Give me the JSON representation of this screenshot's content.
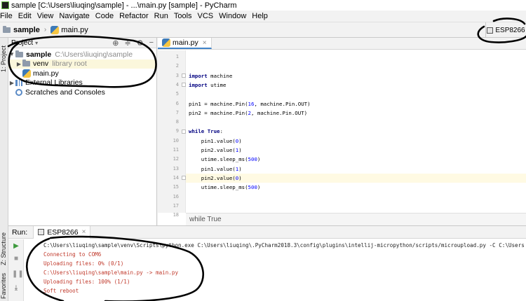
{
  "window": {
    "title": "sample [C:\\Users\\liuqing\\sample] - ...\\main.py [sample] - PyCharm"
  },
  "menu": [
    "File",
    "Edit",
    "View",
    "Navigate",
    "Code",
    "Refactor",
    "Run",
    "Tools",
    "VCS",
    "Window",
    "Help"
  ],
  "nav": {
    "project": "sample",
    "file": "main.py",
    "run_config": "ESP8266"
  },
  "side_tabs": {
    "project": "1: Project",
    "structure": "Z: Structure",
    "favorites": "Favorites"
  },
  "project_panel": {
    "header": "Project",
    "tree": {
      "root_name": "sample",
      "root_path": "C:\\Users\\liuqing\\sample",
      "venv_name": "venv",
      "venv_hint": "library root",
      "file": "main.py",
      "external": "External Libraries",
      "scratches": "Scratches and Consoles"
    }
  },
  "editor": {
    "tab": "main.py",
    "breadcrumb": "while True",
    "current_line": 14,
    "lines": [
      "",
      "",
      "import machine",
      "import utime",
      "",
      "pin1 = machine.Pin(16, machine.Pin.OUT)",
      "pin2 = machine.Pin(2, machine.Pin.OUT)",
      "",
      "while True:",
      "    pin1.value(0)",
      "    pin2.value(1)",
      "    utime.sleep_ms(500)",
      "    pin1.value(1)",
      "    pin2.value(0)",
      "    utime.sleep_ms(500)",
      "",
      "",
      ""
    ]
  },
  "run": {
    "label": "Run:",
    "tab": "ESP8266",
    "output": [
      "C:\\Users\\liuqing\\sample\\venv\\Scripts\\python.exe C:\\Users\\liuqing\\.PyCharm2018.3\\config\\plugins\\intellij-micropython/scripts/microupload.py -C C:\\Users",
      "Connecting to COM6",
      "Uploading files: 0% (0/1)",
      "C:\\Users\\liuqing\\sample\\main.py -> main.py",
      "Uploading files: 100% (1/1)",
      "Soft reboot"
    ]
  },
  "icons": {
    "close": "close-icon",
    "settings": "gear-icon",
    "run": "play-icon",
    "stop": "stop-icon"
  },
  "colors": {
    "accent": "#4083c9",
    "console_text": "#c0392b",
    "annotation_ink": "#000000",
    "current_line": "#fffae3"
  }
}
